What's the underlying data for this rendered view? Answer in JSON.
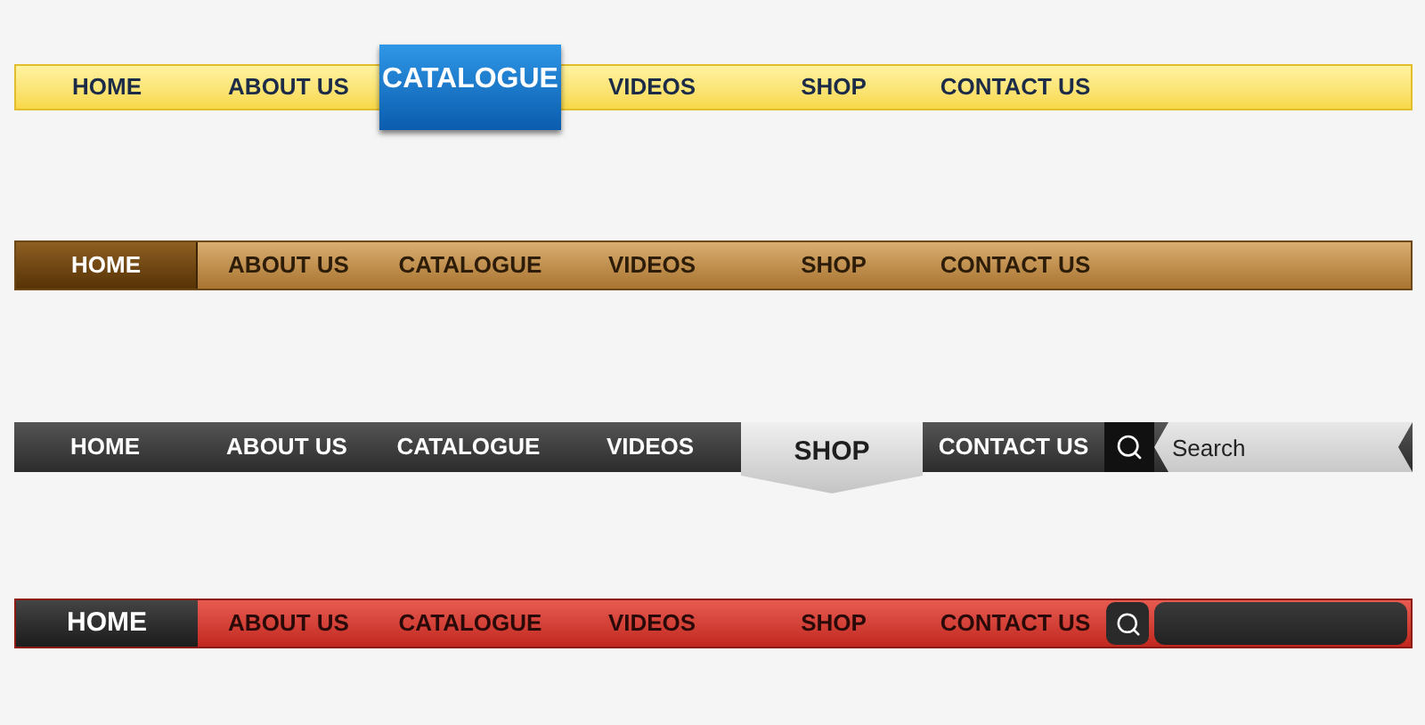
{
  "bars": [
    {
      "kind": "yellow",
      "items": [
        {
          "label": "HOME",
          "selected": false
        },
        {
          "label": "ABOUT US",
          "selected": false
        },
        {
          "label": "CATALOGUE",
          "selected": true
        },
        {
          "label": "VIDEOS",
          "selected": false
        },
        {
          "label": "SHOP",
          "selected": false
        },
        {
          "label": "CONTACT US",
          "selected": false
        }
      ]
    },
    {
      "kind": "brown",
      "items": [
        {
          "label": "HOME",
          "selected": true
        },
        {
          "label": "ABOUT US",
          "selected": false
        },
        {
          "label": "CATALOGUE",
          "selected": false
        },
        {
          "label": "VIDEOS",
          "selected": false
        },
        {
          "label": "SHOP",
          "selected": false
        },
        {
          "label": "CONTACT US",
          "selected": false
        }
      ]
    },
    {
      "kind": "dark",
      "items": [
        {
          "label": "HOME",
          "selected": false
        },
        {
          "label": "ABOUT US",
          "selected": false
        },
        {
          "label": "CATALOGUE",
          "selected": false
        },
        {
          "label": "VIDEOS",
          "selected": false
        },
        {
          "label": "SHOP",
          "selected": true
        },
        {
          "label": "CONTACT US",
          "selected": false
        }
      ],
      "search": {
        "kind": "tag",
        "placeholder": "Search"
      }
    },
    {
      "kind": "red",
      "items": [
        {
          "label": "HOME",
          "selected": true
        },
        {
          "label": "ABOUT US",
          "selected": false
        },
        {
          "label": "CATALOGUE",
          "selected": false
        },
        {
          "label": "VIDEOS",
          "selected": false
        },
        {
          "label": "SHOP",
          "selected": false
        },
        {
          "label": "CONTACT US",
          "selected": false
        }
      ],
      "search": {
        "kind": "pill"
      }
    }
  ]
}
